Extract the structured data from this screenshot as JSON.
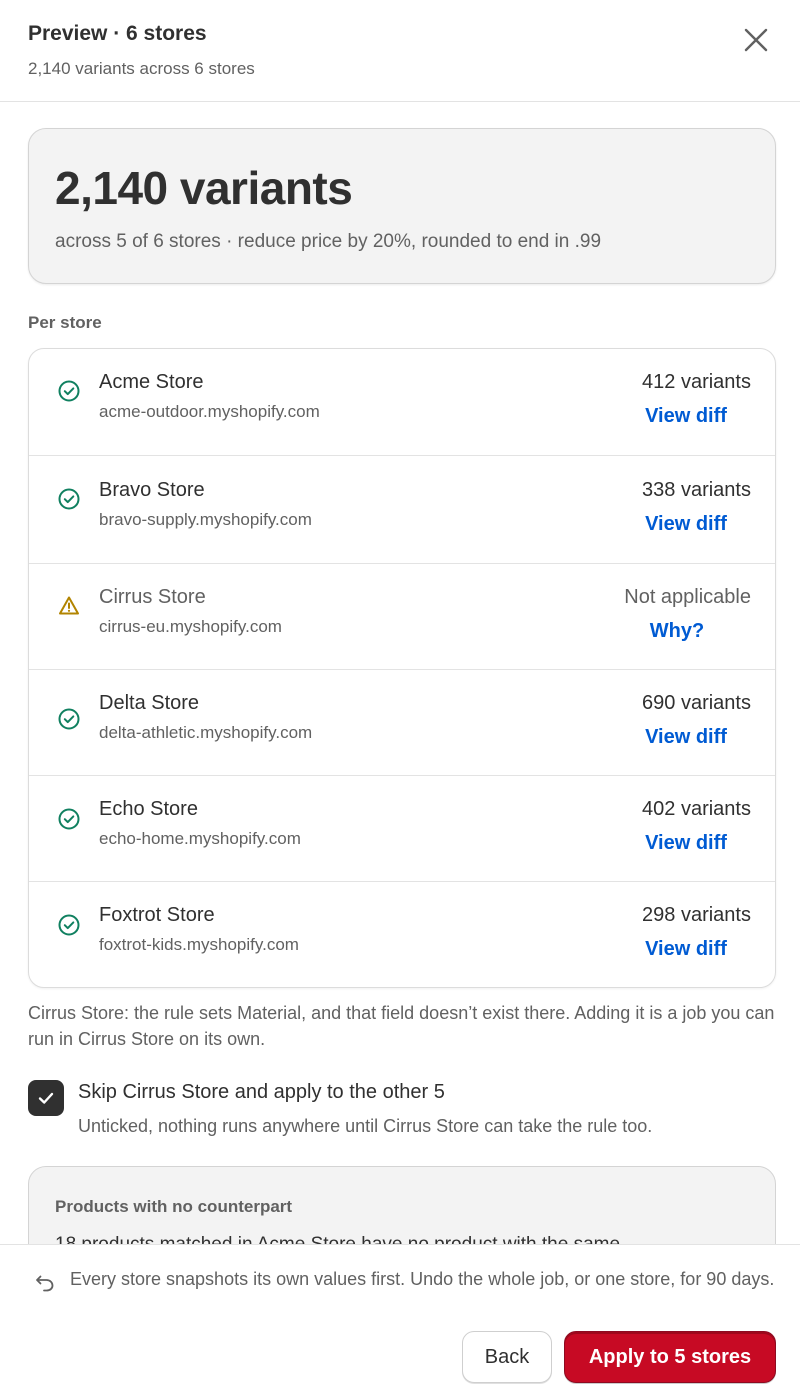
{
  "header": {
    "title": "Preview · 6 stores",
    "subtitle": "2,140 variants across 6 stores",
    "close_icon": "close-icon"
  },
  "summary": {
    "headline": "2,140 variants",
    "description": "across 5 of 6 stores · reduce price by 20%, rounded to end in .99"
  },
  "per_store": {
    "label": "Per store",
    "stores": [
      {
        "name": "Acme Store",
        "domain": "acme-outdoor.myshopify.com",
        "count": "412 variants",
        "link": "View diff",
        "status": "success"
      },
      {
        "name": "Bravo Store",
        "domain": "bravo-supply.myshopify.com",
        "count": "338 variants",
        "link": "View diff",
        "status": "success"
      },
      {
        "name": "Cirrus Store",
        "domain": "cirrus-eu.myshopify.com",
        "count": "Not applicable",
        "link": "Why?",
        "status": "warning"
      },
      {
        "name": "Delta Store",
        "domain": "delta-athletic.myshopify.com",
        "count": "690 variants",
        "link": "View diff",
        "status": "success"
      },
      {
        "name": "Echo Store",
        "domain": "echo-home.myshopify.com",
        "count": "402 variants",
        "link": "View diff",
        "status": "success"
      },
      {
        "name": "Foxtrot Store",
        "domain": "foxtrot-kids.myshopify.com",
        "count": "298 variants",
        "link": "View diff",
        "status": "success"
      }
    ]
  },
  "note": {
    "text": "Cirrus Store: the rule sets Material, and that field doesn’t exist there. Adding it is a job you can run in Cirrus Store on its own."
  },
  "skip": {
    "checked": true,
    "label": "Skip Cirrus Store and apply to the other 5",
    "help": "Unticked, nothing runs anywhere until Cirrus Store can take the rule too."
  },
  "products": {
    "title": "Products with no counterpart",
    "body": "18 products matched in Acme Store have no product with the same"
  },
  "footer": {
    "undo_text": "Every store snapshots its own values first. Undo the whole job, or one store, for 90 days.",
    "back_label": "Back",
    "apply_label": "Apply to 5 stores"
  },
  "colors": {
    "accent": "#c70a24",
    "link": "#005bd3",
    "success": "#108060",
    "warning": "#b28400",
    "text": "#303030",
    "muted": "#616161"
  }
}
